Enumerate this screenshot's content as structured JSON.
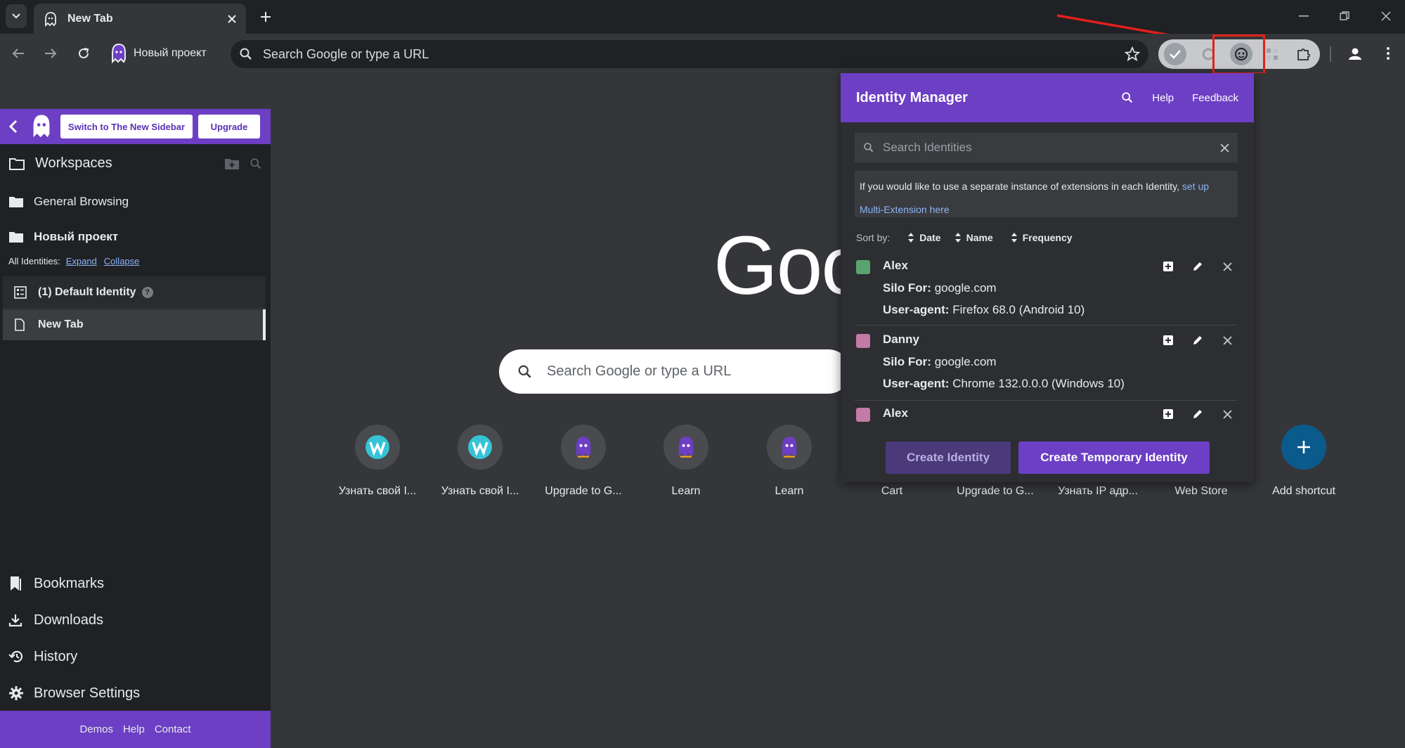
{
  "browser": {
    "tab_title": "New Tab",
    "omnibox_placeholder": "Search Google or type a URL",
    "profile_name": "Новый проект"
  },
  "sidebar": {
    "switch_label": "Switch to The New Sidebar",
    "upgrade_label": "Upgrade",
    "workspaces_label": "Workspaces",
    "workspace_items": [
      "General Browsing",
      "Новый проект"
    ],
    "all_identities_label": "All Identities:",
    "expand_label": "Expand",
    "collapse_label": "Collapse",
    "identity_label": "(1) Default Identity",
    "new_tab_label": "New Tab",
    "bottom_items": [
      "Bookmarks",
      "Downloads",
      "History",
      "Browser Settings"
    ],
    "footer_links": [
      "Demos",
      "Help",
      "Contact"
    ]
  },
  "ntp": {
    "logo_text": "Goog",
    "search_placeholder": "Search Google or type a URL",
    "shortcuts": [
      {
        "label": "Узнать свой I...",
        "icon": "w-icon"
      },
      {
        "label": "Узнать свой I...",
        "icon": "w-icon"
      },
      {
        "label": "Upgrade to G...",
        "icon": "ghost-icon"
      },
      {
        "label": "Learn",
        "icon": "ghost-icon"
      },
      {
        "label": "Learn",
        "icon": "ghost-icon"
      },
      {
        "label": "Cart",
        "icon": "none"
      },
      {
        "label": "Upgrade to G...",
        "icon": "none"
      },
      {
        "label": "Узнать IP адр...",
        "icon": "none"
      },
      {
        "label": "Web Store",
        "icon": "none"
      },
      {
        "label": "Add shortcut",
        "icon": "plus-icon"
      }
    ]
  },
  "popup": {
    "title": "Identity Manager",
    "help_label": "Help",
    "feedback_label": "Feedback",
    "search_placeholder": "Search Identities",
    "info_text": "If you would like to use a separate instance of extensions in each Identity, ",
    "info_link": "set up Multi-Extension here",
    "sort_label": "Sort by:",
    "sort_options": [
      "Date",
      "Name",
      "Frequency"
    ],
    "silo_prefix": "Silo For:",
    "ua_prefix": "User-agent:",
    "identities": [
      {
        "name": "Alex",
        "color": "#5aa36f",
        "silo": "google.com",
        "ua": "Firefox 68.0 (Android 10)"
      },
      {
        "name": "Danny",
        "color": "#c27aa6",
        "silo": "google.com",
        "ua": "Chrome 132.0.0.0 (Windows 10)"
      },
      {
        "name": "Alex",
        "color": "#c27aa6",
        "silo": "",
        "ua": ""
      }
    ],
    "create_label": "Create Identity",
    "create_temp_label": "Create Temporary Identity"
  },
  "colors": {
    "accent": "#6c3fc4",
    "highlight": "#e3201b"
  }
}
